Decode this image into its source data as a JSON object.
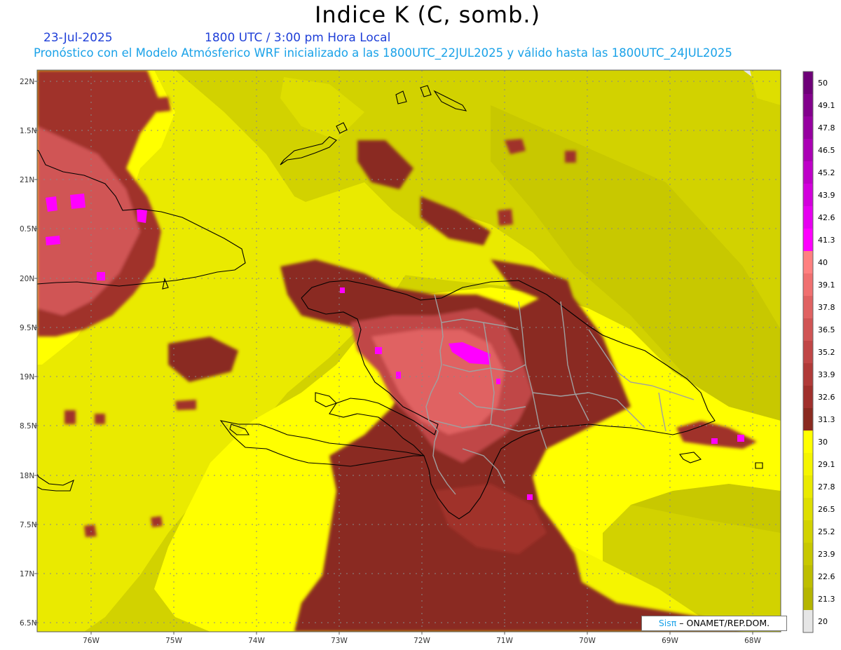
{
  "header": {
    "title": "Indice K (C, somb.)",
    "date": "23-Jul-2025",
    "time": "1800 UTC / 3:00 pm Hora Local",
    "description": "Pronóstico con el Modelo Atmósferico WRF inicializado a las 1800UTC_22JUL2025 y válido hasta las  1800UTC_24JUL2025"
  },
  "axes": {
    "lat_labels": [
      "22N",
      "1.5N",
      "21N",
      "0.5N",
      "20N",
      "9.5N",
      "19N",
      "8.5N",
      "18N",
      "7.5N",
      "17N",
      "6.5N"
    ],
    "lon_labels": [
      "76W",
      "75W",
      "74W",
      "73W",
      "72W",
      "71W",
      "70W",
      "69W",
      "68W"
    ]
  },
  "colorbar": {
    "labels": [
      "50",
      "49.1",
      "47.8",
      "46.5",
      "45.2",
      "43.9",
      "42.6",
      "41.3",
      "40",
      "39.1",
      "37.8",
      "36.5",
      "35.2",
      "33.9",
      "32.6",
      "31.3",
      "30",
      "29.1",
      "27.8",
      "26.5",
      "25.2",
      "23.9",
      "22.6",
      "21.3",
      "20"
    ],
    "colors": [
      "#6e0078",
      "#82008c",
      "#9600a0",
      "#aa00b4",
      "#be00c8",
      "#d200dc",
      "#e600f0",
      "#ff00ff",
      "#ff8080",
      "#f07070",
      "#e06262",
      "#d05454",
      "#c04646",
      "#b03a38",
      "#a0302c",
      "#8a2a20",
      "#ffff00",
      "#f5f500",
      "#eaea00",
      "#dede00",
      "#d2d200",
      "#c8c800",
      "#bebe00",
      "#b5b500",
      "#e6e6e6"
    ]
  },
  "credit": {
    "brand": "Sisπ",
    "text": "– ONAMET/REP.DOM."
  },
  "colors": {
    "background": "#e6e6e6",
    "title_blue": "#1f3fd8",
    "subtitle_cyan": "#1aa2e8"
  }
}
